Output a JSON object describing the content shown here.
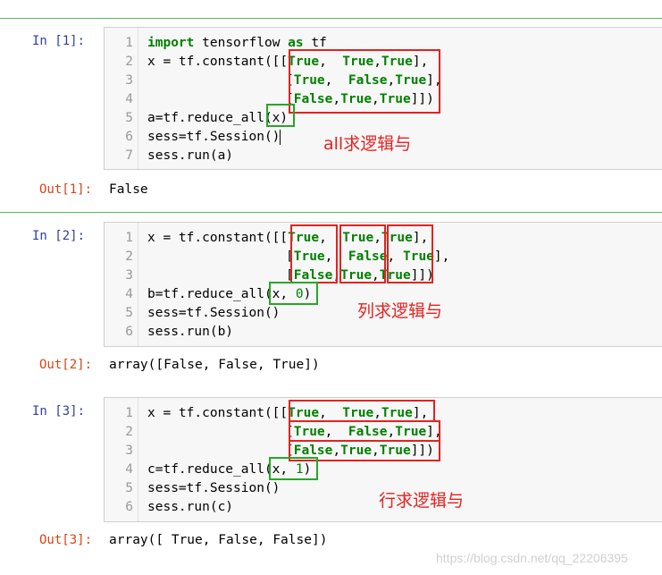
{
  "cells": [
    {
      "in_prompt": "In  [1]:",
      "out_prompt": "Out[1]:",
      "output": "False",
      "annotation": "all求逻辑与",
      "line_numbers": [
        "1",
        "2",
        "3",
        "4",
        "5",
        "6",
        "7"
      ]
    },
    {
      "in_prompt": "In  [2]:",
      "out_prompt": "Out[2]:",
      "output": "array([False, False,  True])",
      "annotation": "列求逻辑与",
      "line_numbers": [
        "1",
        "2",
        "3",
        "4",
        "5",
        "6"
      ]
    },
    {
      "in_prompt": "In  [3]:",
      "out_prompt": "Out[3]:",
      "output": "array([ True, False, False])",
      "annotation": "行求逻辑与",
      "line_numbers": [
        "1",
        "2",
        "3",
        "4",
        "5",
        "6"
      ]
    }
  ],
  "code": {
    "import_kw": "import",
    "tf_module": "tensorflow",
    "as_kw": "as",
    "tf_alias": "tf",
    "constant_prefix": "x = tf.constant([[",
    "row_open": "[",
    "t": "True",
    "f": "False",
    "comma_sp": ", ",
    "comma": ",",
    "comma_sp2": ",  ",
    "row1_close": "],",
    "row3_close": "]])",
    "c1_line_a": "a=tf.reduce_all(x)",
    "c2_line_b": "b=tf.reduce_all(x, ",
    "c3_line_c": "c=tf.reduce_all(x, ",
    "zero": "0",
    "one": "1",
    "close_paren": ")",
    "session_line": "sess=tf.Session()",
    "run_a": "sess.run(a)",
    "run_b": "sess.run(b)",
    "run_c": "sess.run(c)"
  },
  "watermark": "https://blog.csdn.net/qq_22206395",
  "colors": {
    "in_prompt": "#303f9f",
    "out_prompt": "#d84315",
    "keyword": "#008000",
    "highlight_red": "#e4221f",
    "highlight_green": "#2aa52a",
    "cell_separator": "#5cb85c"
  }
}
